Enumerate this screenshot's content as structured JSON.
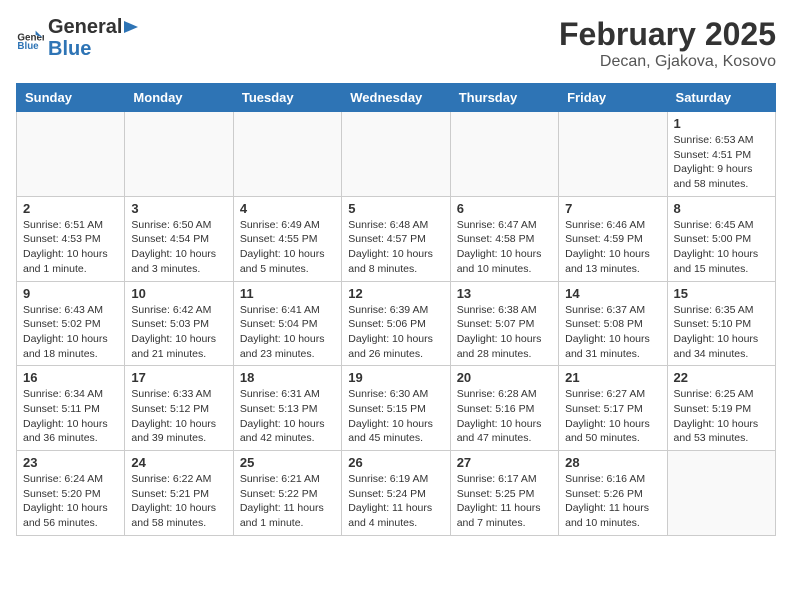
{
  "header": {
    "logo_general": "General",
    "logo_blue": "Blue",
    "title": "February 2025",
    "subtitle": "Decan, Gjakova, Kosovo"
  },
  "weekdays": [
    "Sunday",
    "Monday",
    "Tuesday",
    "Wednesday",
    "Thursday",
    "Friday",
    "Saturday"
  ],
  "weeks": [
    [
      {
        "day": "",
        "info": ""
      },
      {
        "day": "",
        "info": ""
      },
      {
        "day": "",
        "info": ""
      },
      {
        "day": "",
        "info": ""
      },
      {
        "day": "",
        "info": ""
      },
      {
        "day": "",
        "info": ""
      },
      {
        "day": "1",
        "info": "Sunrise: 6:53 AM\nSunset: 4:51 PM\nDaylight: 9 hours and 58 minutes."
      }
    ],
    [
      {
        "day": "2",
        "info": "Sunrise: 6:51 AM\nSunset: 4:53 PM\nDaylight: 10 hours and 1 minute."
      },
      {
        "day": "3",
        "info": "Sunrise: 6:50 AM\nSunset: 4:54 PM\nDaylight: 10 hours and 3 minutes."
      },
      {
        "day": "4",
        "info": "Sunrise: 6:49 AM\nSunset: 4:55 PM\nDaylight: 10 hours and 5 minutes."
      },
      {
        "day": "5",
        "info": "Sunrise: 6:48 AM\nSunset: 4:57 PM\nDaylight: 10 hours and 8 minutes."
      },
      {
        "day": "6",
        "info": "Sunrise: 6:47 AM\nSunset: 4:58 PM\nDaylight: 10 hours and 10 minutes."
      },
      {
        "day": "7",
        "info": "Sunrise: 6:46 AM\nSunset: 4:59 PM\nDaylight: 10 hours and 13 minutes."
      },
      {
        "day": "8",
        "info": "Sunrise: 6:45 AM\nSunset: 5:00 PM\nDaylight: 10 hours and 15 minutes."
      }
    ],
    [
      {
        "day": "9",
        "info": "Sunrise: 6:43 AM\nSunset: 5:02 PM\nDaylight: 10 hours and 18 minutes."
      },
      {
        "day": "10",
        "info": "Sunrise: 6:42 AM\nSunset: 5:03 PM\nDaylight: 10 hours and 21 minutes."
      },
      {
        "day": "11",
        "info": "Sunrise: 6:41 AM\nSunset: 5:04 PM\nDaylight: 10 hours and 23 minutes."
      },
      {
        "day": "12",
        "info": "Sunrise: 6:39 AM\nSunset: 5:06 PM\nDaylight: 10 hours and 26 minutes."
      },
      {
        "day": "13",
        "info": "Sunrise: 6:38 AM\nSunset: 5:07 PM\nDaylight: 10 hours and 28 minutes."
      },
      {
        "day": "14",
        "info": "Sunrise: 6:37 AM\nSunset: 5:08 PM\nDaylight: 10 hours and 31 minutes."
      },
      {
        "day": "15",
        "info": "Sunrise: 6:35 AM\nSunset: 5:10 PM\nDaylight: 10 hours and 34 minutes."
      }
    ],
    [
      {
        "day": "16",
        "info": "Sunrise: 6:34 AM\nSunset: 5:11 PM\nDaylight: 10 hours and 36 minutes."
      },
      {
        "day": "17",
        "info": "Sunrise: 6:33 AM\nSunset: 5:12 PM\nDaylight: 10 hours and 39 minutes."
      },
      {
        "day": "18",
        "info": "Sunrise: 6:31 AM\nSunset: 5:13 PM\nDaylight: 10 hours and 42 minutes."
      },
      {
        "day": "19",
        "info": "Sunrise: 6:30 AM\nSunset: 5:15 PM\nDaylight: 10 hours and 45 minutes."
      },
      {
        "day": "20",
        "info": "Sunrise: 6:28 AM\nSunset: 5:16 PM\nDaylight: 10 hours and 47 minutes."
      },
      {
        "day": "21",
        "info": "Sunrise: 6:27 AM\nSunset: 5:17 PM\nDaylight: 10 hours and 50 minutes."
      },
      {
        "day": "22",
        "info": "Sunrise: 6:25 AM\nSunset: 5:19 PM\nDaylight: 10 hours and 53 minutes."
      }
    ],
    [
      {
        "day": "23",
        "info": "Sunrise: 6:24 AM\nSunset: 5:20 PM\nDaylight: 10 hours and 56 minutes."
      },
      {
        "day": "24",
        "info": "Sunrise: 6:22 AM\nSunset: 5:21 PM\nDaylight: 10 hours and 58 minutes."
      },
      {
        "day": "25",
        "info": "Sunrise: 6:21 AM\nSunset: 5:22 PM\nDaylight: 11 hours and 1 minute."
      },
      {
        "day": "26",
        "info": "Sunrise: 6:19 AM\nSunset: 5:24 PM\nDaylight: 11 hours and 4 minutes."
      },
      {
        "day": "27",
        "info": "Sunrise: 6:17 AM\nSunset: 5:25 PM\nDaylight: 11 hours and 7 minutes."
      },
      {
        "day": "28",
        "info": "Sunrise: 6:16 AM\nSunset: 5:26 PM\nDaylight: 11 hours and 10 minutes."
      },
      {
        "day": "",
        "info": ""
      }
    ]
  ]
}
